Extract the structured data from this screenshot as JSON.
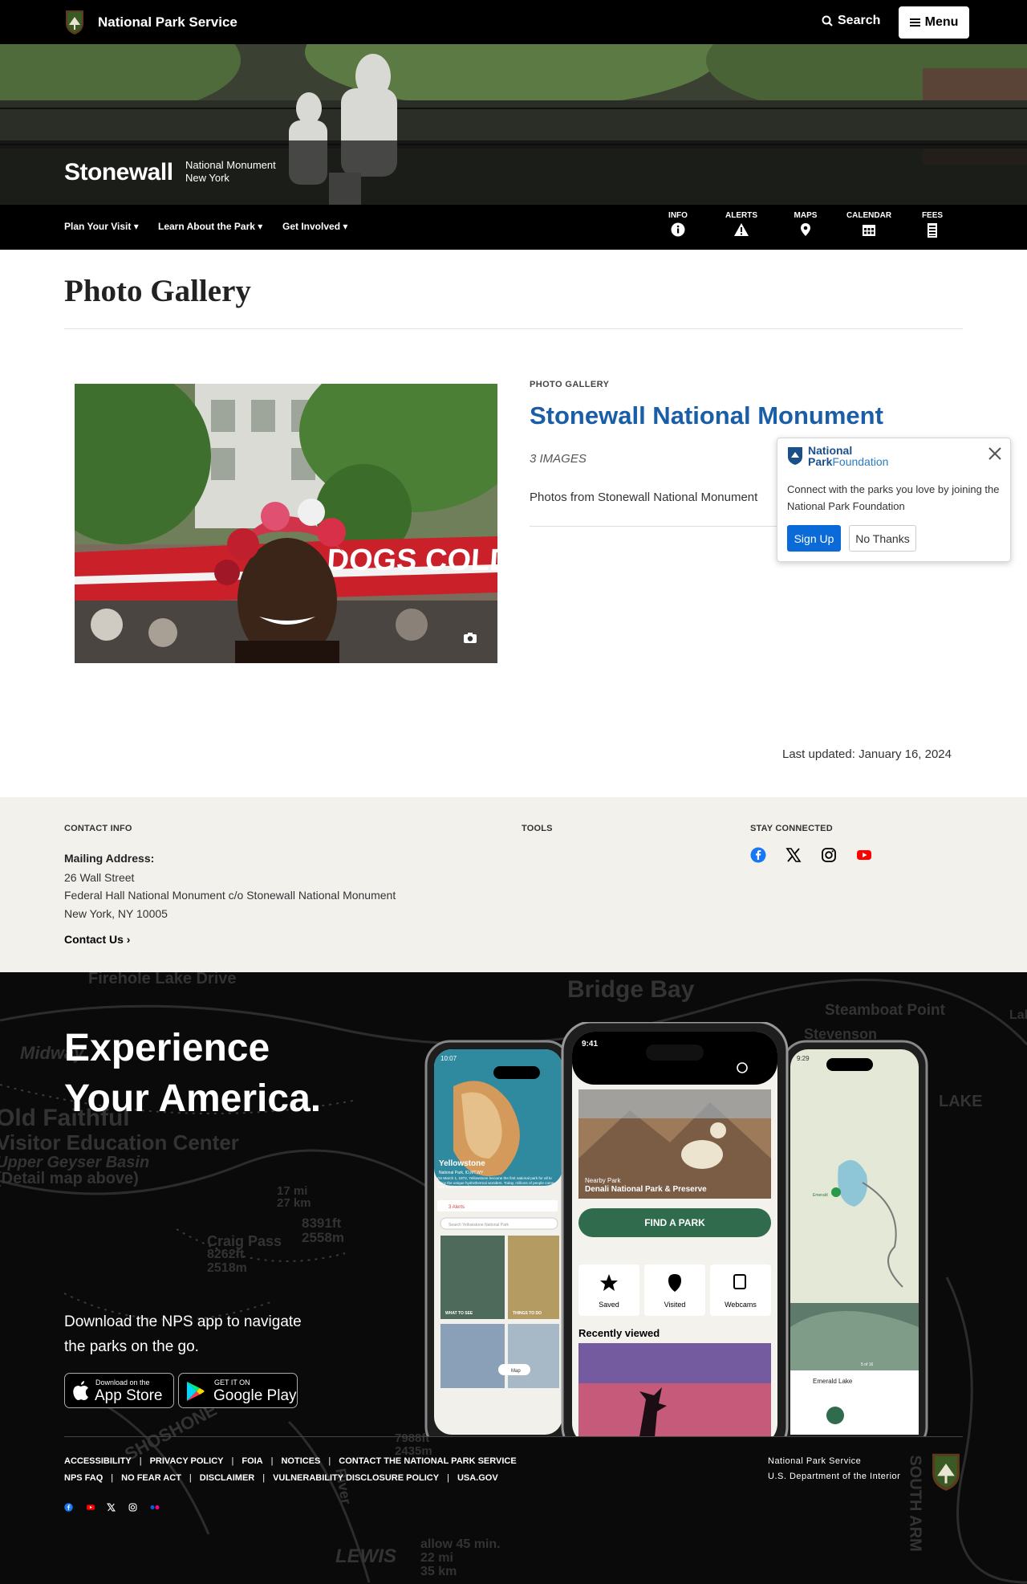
{
  "header": {
    "brand": "National Park Service",
    "search_label": "Search",
    "menu_label": "Menu"
  },
  "hero": {
    "park_name": "Stonewall",
    "designation": "National Monument",
    "state": "New York"
  },
  "park_nav": {
    "items": [
      "Plan Your Visit",
      "Learn About the Park",
      "Get Involved"
    ],
    "quick": [
      "INFO",
      "ALERTS",
      "MAPS",
      "CALENDAR",
      "FEES"
    ]
  },
  "page_title": "Photo Gallery",
  "gallery": {
    "kicker": "PHOTO GALLERY",
    "title": "Stonewall National Monument",
    "count": "3 IMAGES",
    "description": "Photos from Stonewall National Monument",
    "photo_sign": "DOGS COLD DRI"
  },
  "popup": {
    "logo_line1": "National",
    "logo_line2a": "Park",
    "logo_line2b": "Foundation",
    "message": "Connect with the parks you love by joining the National Park Foundation",
    "signup_label": "Sign Up",
    "nothanks_label": "No Thanks"
  },
  "last_updated": "Last updated: January 16, 2024",
  "contact": {
    "heading": "CONTACT INFO",
    "mailing_label": "Mailing Address:",
    "address_lines": [
      "26 Wall Street",
      "Federal Hall National Monument c/o Stonewall National Monument",
      "New York, NY 10005"
    ],
    "contact_us": "Contact Us",
    "tools_heading": "TOOLS",
    "stay_heading": "STAY CONNECTED"
  },
  "promo": {
    "headline_1": "Experience",
    "headline_2": "Your America.",
    "download_text": "Download the NPS app to navigate the parks on the go.",
    "appstore_small": "Download on the",
    "appstore_big": "App Store",
    "googleplay_small": "GET IT ON",
    "googleplay_big": "Google Play",
    "map_labels": [
      "Firehole Lake Drive",
      "Bridge Bay",
      "Steamboat Point",
      "Stevenson",
      "Old Faithful",
      "Visitor Education Center",
      "Upper Geyser Basin",
      "(Detail map above)",
      "Craig Pass",
      "8262ft",
      "2518m",
      "8391ft",
      "2558m",
      "17 mi",
      "27 km",
      "LEWIS",
      "allow 45 min.",
      "22 mi",
      "35 km",
      "SHOSHONE",
      "SOUTH ARM",
      "7988ft",
      "2435m",
      "Midway",
      "Lake",
      "LAKE",
      "River"
    ],
    "phone_left": {
      "time": "10:07",
      "title": "Yellowstone",
      "subtitle": "National Park, ID,MT,WY",
      "blurb": "On March 1, 1872, Yellowstone became the first national park for all to enjoy the unique hydrothermal wonders. Today, millions of people come here each y... Read",
      "alerts": "3 Alerts",
      "search_placeholder": "Search Yellowstone National Park",
      "tiles": [
        "WHAT TO SEE",
        "THINGS TO DO"
      ],
      "map_button": "Map"
    },
    "phone_center": {
      "time": "9:41",
      "nearby_label": "Nearby Park",
      "nearby_name": "Denali National Park & Preserve",
      "find_button": "FIND A PARK",
      "tiles": [
        "Saved",
        "Visited",
        "Webcams"
      ],
      "recent": "Recently viewed"
    },
    "phone_right": {
      "time": "9:29",
      "lake_label": "Emerald",
      "place_title": "Emerald Lake",
      "photo_count": "5 of 16"
    }
  },
  "footer": {
    "links_row1": [
      "ACCESSIBILITY",
      "PRIVACY POLICY",
      "FOIA",
      "NOTICES",
      "CONTACT THE NATIONAL PARK SERVICE"
    ],
    "links_row2": [
      "NPS FAQ",
      "NO FEAR ACT",
      "DISCLAIMER",
      "VULNERABILITY DISCLOSURE POLICY",
      "USA.GOV"
    ],
    "agency": "National Park Service",
    "department": "U.S. Department of the Interior"
  },
  "colors": {
    "link_blue": "#1a5ea8",
    "signup_blue": "#0a6ad8",
    "find_green": "#2f6b4c",
    "facebook": "#1877f2",
    "youtube": "#ff0000"
  },
  "icons": [
    "arrowhead-logo",
    "search-icon",
    "hamburger-icon",
    "info-icon",
    "alert-icon",
    "map-pin-icon",
    "calendar-icon",
    "fees-icon",
    "camera-icon",
    "close-icon",
    "facebook-icon",
    "x-icon",
    "instagram-icon",
    "youtube-icon",
    "flickr-icon",
    "apple-icon",
    "google-play-icon"
  ]
}
